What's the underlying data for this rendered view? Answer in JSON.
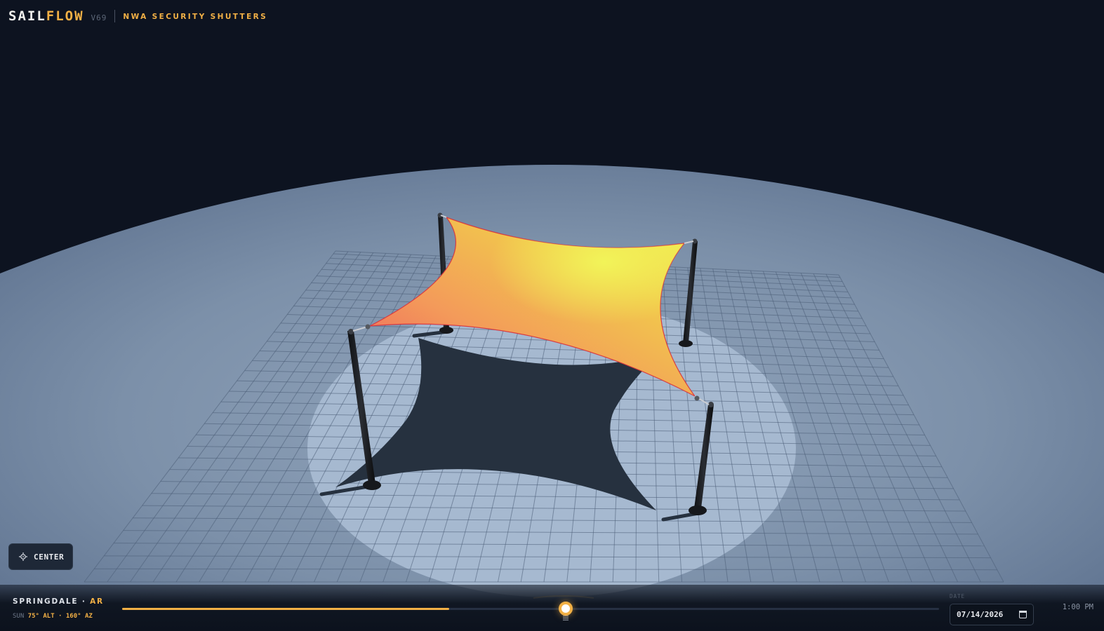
{
  "brand": {
    "name_a": "SAIL",
    "name_b": "FLOW",
    "version": "V69",
    "client": "NWA SECURITY SHUTTERS"
  },
  "controls": {
    "center_label": "CENTER"
  },
  "location": {
    "city": "SPRINGDALE",
    "sep": " · ",
    "state": "AR"
  },
  "sun": {
    "prefix": "SUN",
    "readout": "75° ALT · 160° AZ"
  },
  "timeline": {
    "progress": 0.4
  },
  "date": {
    "label": "DATE",
    "value": "07/14/2026"
  },
  "time": {
    "value": "1:00 PM"
  },
  "colors": {
    "accent": "#f2b045",
    "background": "#0d1320",
    "ground": "#8a9db6",
    "sail_warm": "#f07060",
    "sail_bright": "#eef050",
    "shadow": "#26313f"
  },
  "icons": {
    "center": "crosshair-icon",
    "date": "calendar-icon"
  }
}
